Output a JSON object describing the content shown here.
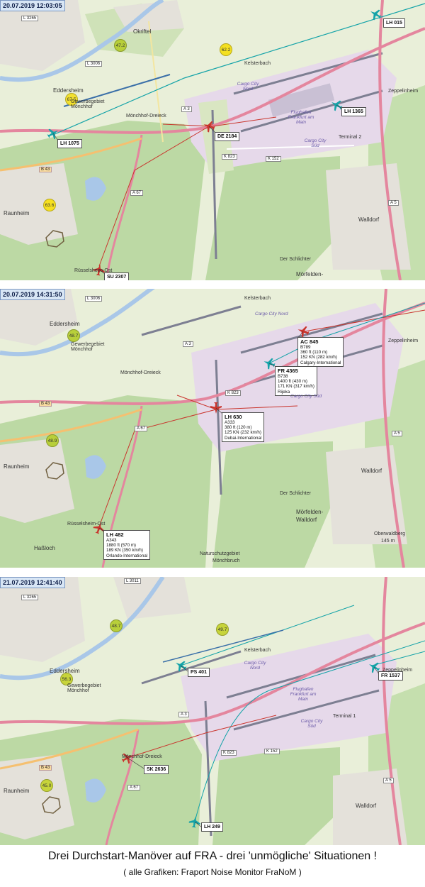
{
  "panels": [
    {
      "timestamp": "20.07.2019 12:03:05",
      "aircraft": [
        {
          "callsign": "LH 015"
        },
        {
          "callsign": "LH 1365"
        },
        {
          "callsign": "DE 2184"
        },
        {
          "callsign": "LH 1075"
        },
        {
          "callsign": "SU 2307"
        }
      ],
      "noise_levels": [
        "47.2",
        "62.2",
        "67.5",
        "63.6"
      ],
      "places": [
        "Okriftel",
        "Eddersheim",
        "Raunheim",
        "Walldorf",
        "Mörfelden-",
        "Kelsterbach",
        "Cargo City Nord",
        "Flughafen Frankfurt am Main",
        "Cargo City Süd",
        "Terminal 2",
        "Gewerbegebiet Mönchhof",
        "Mönchhof-Dreieck",
        "Rüsselsheim-Ost",
        "Der Schlichter",
        "Zeppelinheim"
      ],
      "roads": [
        "L 3265",
        "L 3006",
        "B 43",
        "A 3",
        "A 67",
        "K 823",
        "K 152",
        "A 5"
      ]
    },
    {
      "timestamp": "20.07.2019 14:31:50",
      "aircraft": [
        {
          "callsign": "AC 845",
          "lines": [
            "B789",
            "360 ft (110 m)",
            "152 KN (282 km/h)",
            "Calgary-International"
          ]
        },
        {
          "callsign": "FR 4365",
          "lines": [
            "B738",
            "1400 ft (430 m)",
            "171 KN (317 km/h)",
            "Rijeka"
          ]
        },
        {
          "callsign": "LH 630",
          "lines": [
            "A333",
            "380 ft (120 m)",
            "125 KN (232 km/h)",
            "Dubai-International"
          ]
        },
        {
          "callsign": "LH 482",
          "lines": [
            "A343",
            "1880 ft (570 m)",
            "189 KN (350 km/h)",
            "Orlando-International"
          ]
        }
      ],
      "noise_levels": [
        "48.7",
        "48.9"
      ],
      "places": [
        "Eddersheim",
        "Raunheim",
        "Haßloch",
        "Walldorf",
        "Mörfelden-",
        "Walldorf",
        "Kelsterbach",
        "Cargo City Nord",
        "Cargo City Süd",
        "Naturschutzgebiet",
        "Mönchbruch",
        "Oberwaldberg",
        "145 m",
        "Gewerbegebiet Mönchhof",
        "Mönchhof-Dreieck",
        "Rüsselsheim-Ost",
        "Der Schlichter",
        "Zeppelinheim"
      ],
      "roads": [
        "L 3006",
        "B 43",
        "A 3",
        "A 67",
        "K 823",
        "A 5"
      ]
    },
    {
      "timestamp": "21.07.2019 12:41:40",
      "aircraft": [
        {
          "callsign": "PS 401"
        },
        {
          "callsign": "FR 1537"
        },
        {
          "callsign": "SK 2636"
        },
        {
          "callsign": "LH 249"
        }
      ],
      "noise_levels": [
        "48.7",
        "49.7",
        "56.3",
        "45.0"
      ],
      "places": [
        "Eddersheim",
        "Raunheim",
        "Walldorf",
        "Kelsterbach",
        "Cargo City Nord",
        "Flughafen Frankfurt am Main",
        "Cargo City Süd",
        "Terminal 1",
        "Gewerbegebiet Mönchhof",
        "Mönchhof-Dreieck",
        "Zeppelinheim"
      ],
      "roads": [
        "L 3265",
        "L 3011",
        "B 43",
        "A 3",
        "A 67",
        "K 823",
        "K 152",
        "A 5"
      ]
    }
  ],
  "caption": {
    "main": "Drei Durchstart-Manöver auf FRA - drei 'unmögliche' Situationen !",
    "sub": "( alle Grafiken: Fraport Noise Monitor FraNoM )"
  },
  "colors": {
    "forest": "#bcd9a4",
    "urban": "#e4e1da",
    "airport": "#e6d9ea",
    "runway": "#7d7f92",
    "motorway": "#e4869e",
    "track_red": "#c9342c",
    "track_teal": "#14a3a8"
  }
}
